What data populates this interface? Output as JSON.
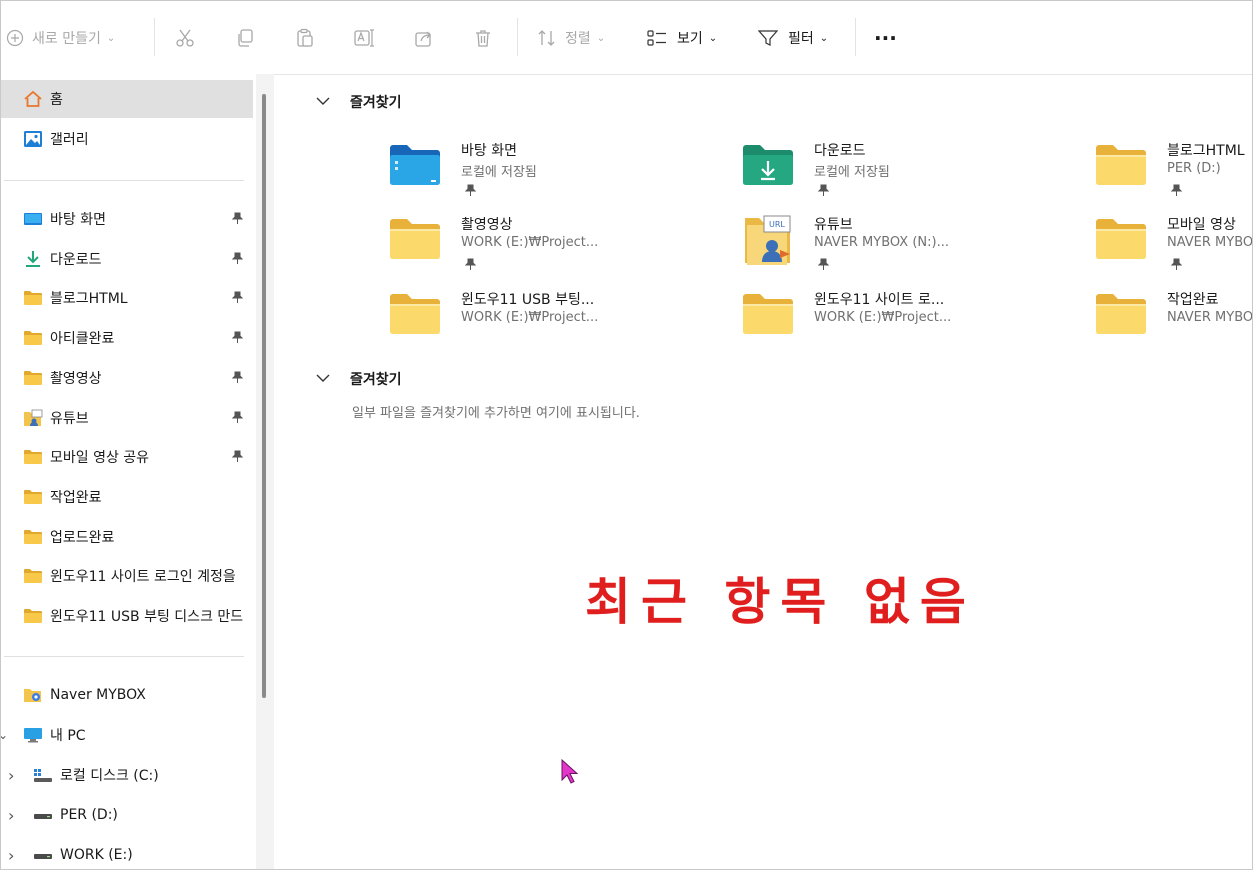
{
  "toolbar": {
    "new_label": "새로 만들기",
    "sort_label": "정렬",
    "view_label": "보기",
    "filter_label": "필터",
    "more_label": "···"
  },
  "sidebar": {
    "home": "홈",
    "gallery": "갤러리",
    "pinned": [
      {
        "label": "바탕 화면",
        "pinned": true
      },
      {
        "label": "다운로드",
        "pinned": true
      },
      {
        "label": "블로그HTML",
        "pinned": true
      },
      {
        "label": "아티클완료",
        "pinned": true
      },
      {
        "label": "촬영영상",
        "pinned": true
      },
      {
        "label": "유튜브",
        "pinned": true
      },
      {
        "label": "모바일 영상 공유",
        "pinned": true
      },
      {
        "label": "작업완료",
        "pinned": false
      },
      {
        "label": "업로드완료",
        "pinned": false
      },
      {
        "label": "윈도우11 사이트 로그인 계정을",
        "pinned": false
      },
      {
        "label": "윈도우11 USB 부팅 디스크 만드",
        "pinned": false
      }
    ],
    "naver": "Naver MYBOX",
    "mypc": "내 PC",
    "drives": [
      {
        "label": "로컬 디스크 (C:)"
      },
      {
        "label": "PER (D:)"
      },
      {
        "label": "WORK (E:)"
      }
    ]
  },
  "main": {
    "section1_title": "즐겨찾기",
    "tiles": [
      {
        "name": "바탕 화면",
        "sub": "로컬에 저장됨",
        "icon": "desktop-folder-icon"
      },
      {
        "name": "다운로드",
        "sub": "로컬에 저장됨",
        "icon": "downloads-folder-icon"
      },
      {
        "name": "블로그HTML",
        "sub": "PER (D:)",
        "icon": "folder-icon"
      },
      {
        "name": "촬영영상",
        "sub": "WORK (E:)₩Project...",
        "icon": "folder-icon"
      },
      {
        "name": "유튜브",
        "sub": "NAVER MYBOX (N:)...",
        "icon": "url-folder-icon"
      },
      {
        "name": "모바일 영상",
        "sub": "NAVER MYBO",
        "icon": "folder-icon"
      },
      {
        "name": "윈도우11 USB 부팅...",
        "sub": "WORK (E:)₩Project...",
        "icon": "folder-icon"
      },
      {
        "name": "윈도우11 사이트 로...",
        "sub": "WORK (E:)₩Project...",
        "icon": "folder-icon"
      },
      {
        "name": "작업완료",
        "sub": "NAVER MYBO",
        "icon": "folder-icon"
      }
    ],
    "section2_title": "즐겨찾기",
    "section2_empty": "일부 파일을 즐겨찾기에 추가하면 여기에 표시됩니다.",
    "overlay_text": "최근 항목 없음"
  }
}
